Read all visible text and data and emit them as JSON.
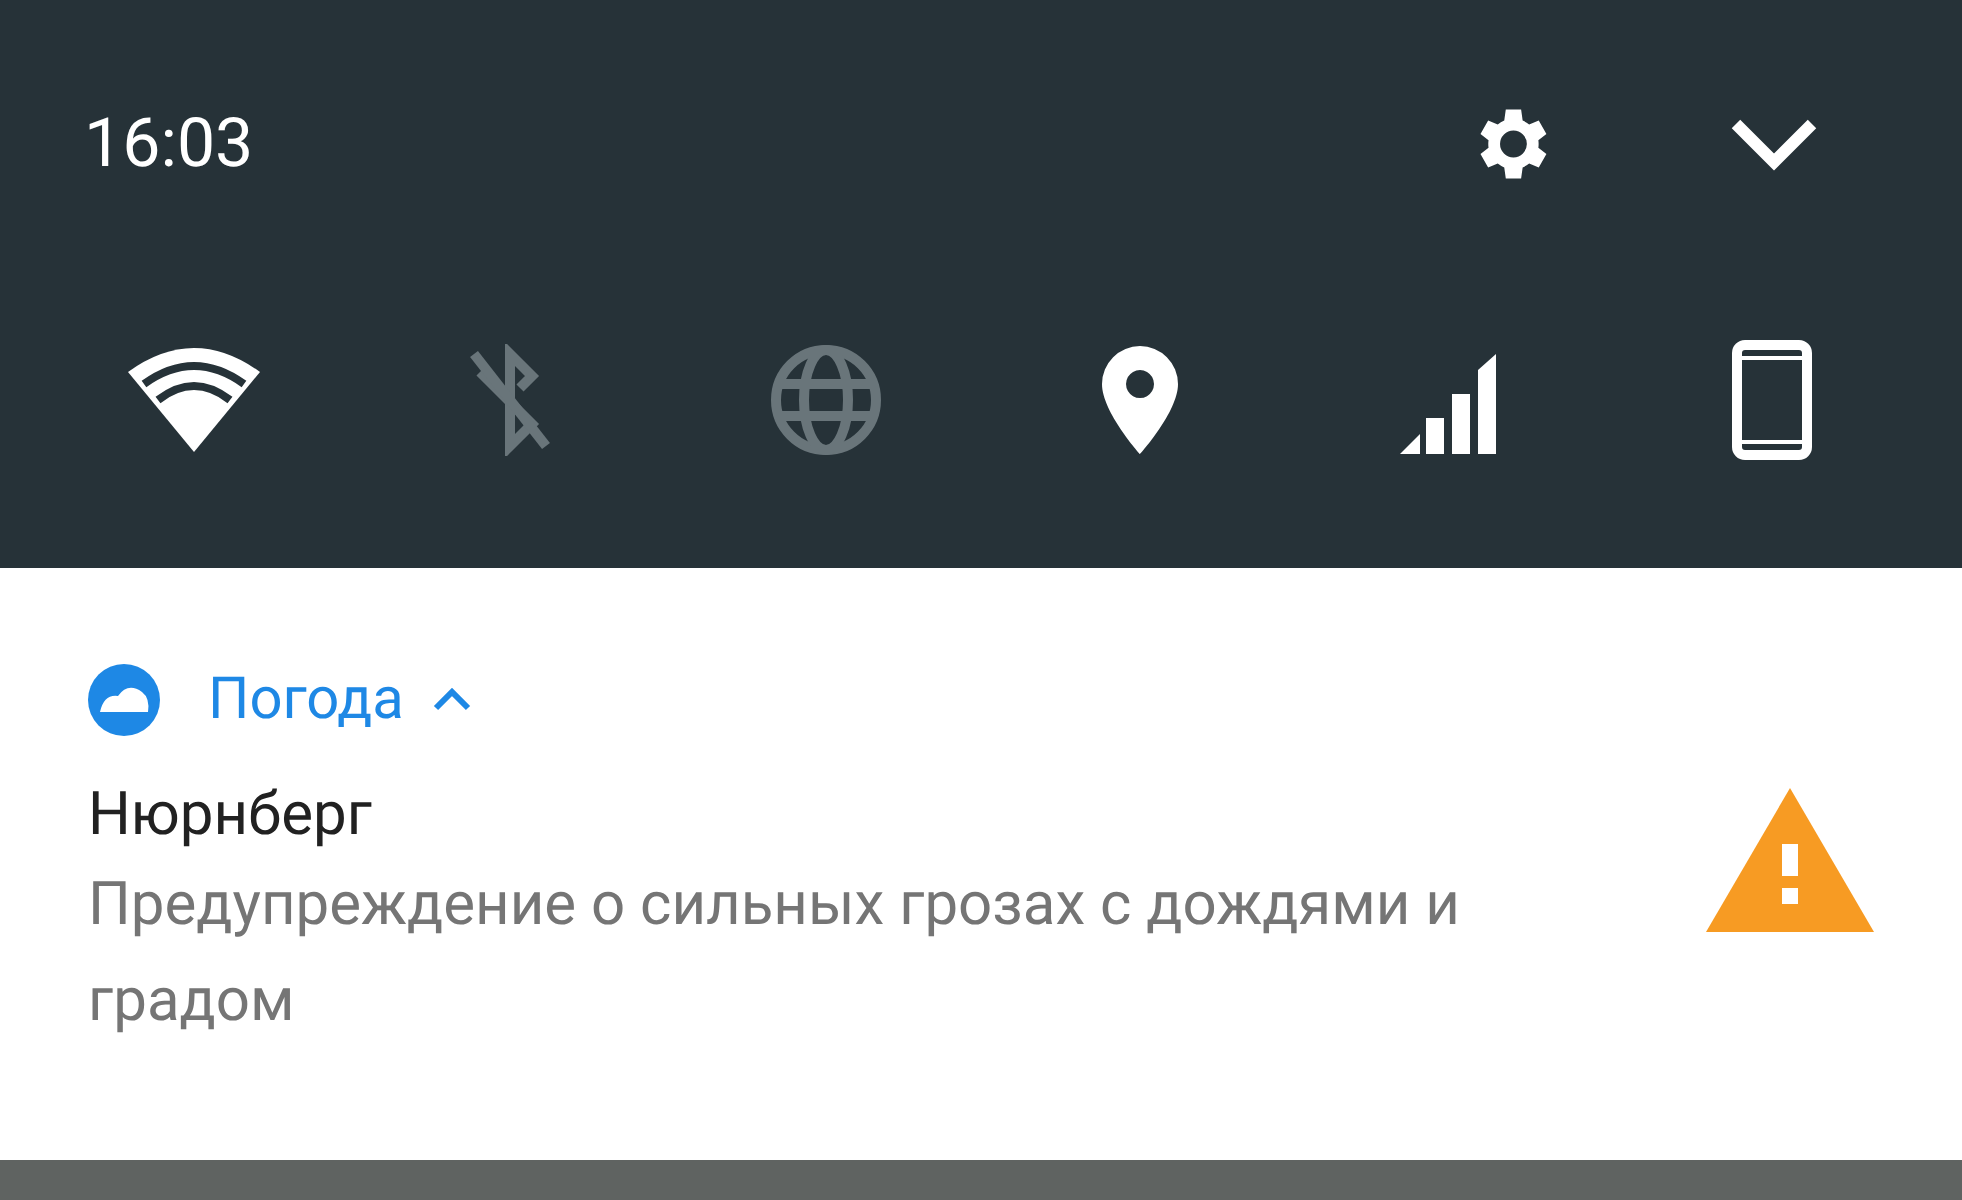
{
  "status": {
    "time": "16:03"
  },
  "quick_settings": [
    {
      "kind": "wifi",
      "on": true
    },
    {
      "kind": "bluetooth",
      "on": false
    },
    {
      "kind": "data",
      "on": false
    },
    {
      "kind": "location",
      "on": true
    },
    {
      "kind": "signal",
      "on": true
    },
    {
      "kind": "rotation",
      "on": true
    }
  ],
  "notification": {
    "app": "Погода",
    "expanded": true,
    "title": "Нюрнберг",
    "text": "Предупреждение о сильных грозах с дождями и градом",
    "kind": "warning"
  }
}
